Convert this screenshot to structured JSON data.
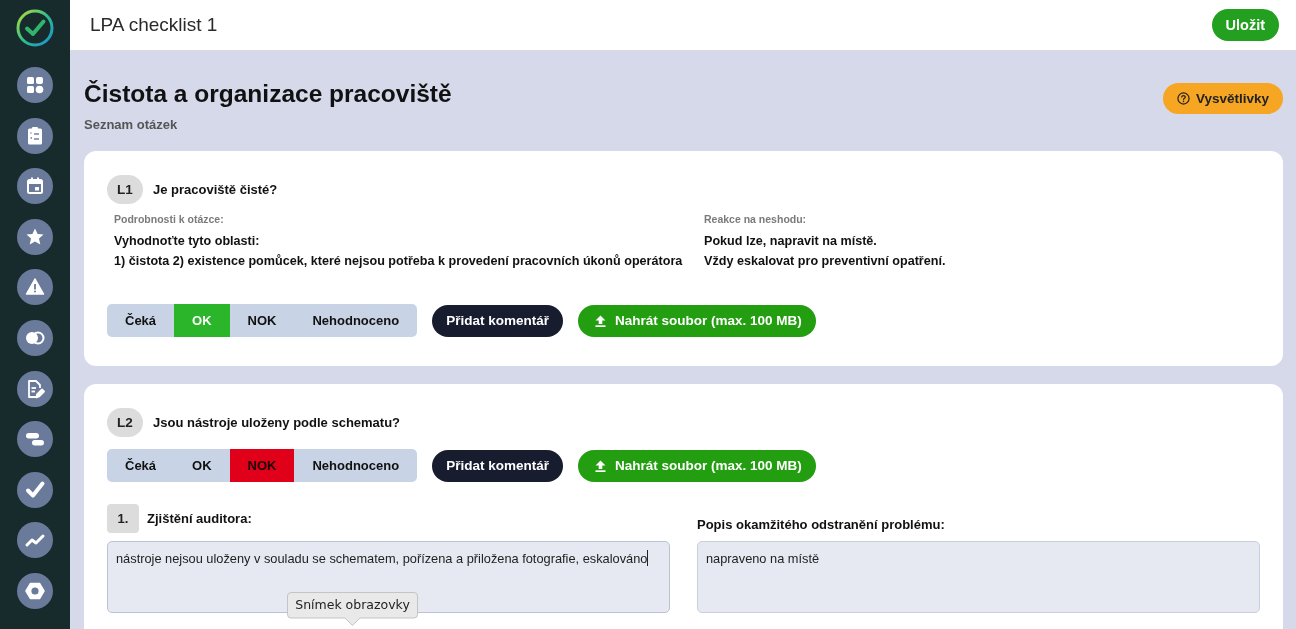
{
  "header": {
    "title": "LPA checklist 1",
    "save_button": "Uložit"
  },
  "section": {
    "title": "Čistota a organizace pracoviště",
    "subtitle": "Seznam otázek",
    "legend_button": "Vysvětlivky"
  },
  "questions": [
    {
      "code": "L1",
      "text": "Je pracoviště čisté?",
      "details": {
        "label": "Podrobnosti k otázce:",
        "lines": [
          "Vyhodnoťte tyto oblasti:",
          "1) čistota 2) existence pomůcek, které nejsou potřeba k provedení pracovních úkonů operátora"
        ]
      },
      "reaction": {
        "label": "Reakce na neshodu:",
        "lines": [
          "Pokud lze, napravit na místě.",
          "Vždy eskalovat pro preventivní opatření."
        ]
      },
      "answers": [
        {
          "label": "Čeká",
          "kind": "pending",
          "selected": false
        },
        {
          "label": "OK",
          "kind": "ok",
          "selected": true
        },
        {
          "label": "NOK",
          "kind": "nok",
          "selected": false
        },
        {
          "label": "Nehodnoceno",
          "kind": "unrated",
          "selected": false
        }
      ],
      "comment_button": "Přidat komentář",
      "upload_button": "Nahrát soubor (max. 100 MB)"
    },
    {
      "code": "L2",
      "text": "Jsou nástroje uloženy podle schematu?",
      "answers": [
        {
          "label": "Čeká",
          "kind": "pending",
          "selected": false
        },
        {
          "label": "OK",
          "kind": "ok",
          "selected": false
        },
        {
          "label": "NOK",
          "kind": "nok",
          "selected": true
        },
        {
          "label": "Nehodnoceno",
          "kind": "unrated",
          "selected": false
        }
      ],
      "comment_button": "Přidat komentář",
      "upload_button": "Nahrát soubor (max. 100 MB)",
      "findings": [
        {
          "number": "1.",
          "auditor": {
            "label": "Zjištění auditora:",
            "value": "nástroje nejsou uloženy v souladu se schematem, pořízena a přiložena fotografie, eskalováno",
            "focused": true
          },
          "fix": {
            "label": "Popis okamžitého odstranění problému:",
            "value": "napraveno na místě",
            "focused": false
          }
        }
      ]
    }
  ],
  "tooltip": {
    "text": "Snímek obrazovky"
  }
}
